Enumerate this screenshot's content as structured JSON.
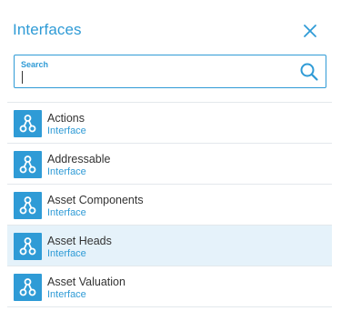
{
  "panel": {
    "title": "Interfaces",
    "close_icon": "close-icon"
  },
  "search": {
    "label": "Search",
    "value": "",
    "placeholder": "",
    "icon": "search-icon"
  },
  "colors": {
    "accent": "#2f9bd6",
    "selected_row": "#e5f2fa",
    "divider": "#e3e8ec"
  },
  "list": {
    "items": [
      {
        "name": "Actions",
        "type": "Interface",
        "icon": "interface-graph-icon",
        "selected": false
      },
      {
        "name": "Addressable",
        "type": "Interface",
        "icon": "interface-graph-icon",
        "selected": false
      },
      {
        "name": "Asset Components",
        "type": "Interface",
        "icon": "interface-graph-icon",
        "selected": false
      },
      {
        "name": "Asset Heads",
        "type": "Interface",
        "icon": "interface-graph-icon",
        "selected": true
      },
      {
        "name": "Asset Valuation",
        "type": "Interface",
        "icon": "interface-graph-icon",
        "selected": false
      }
    ]
  }
}
